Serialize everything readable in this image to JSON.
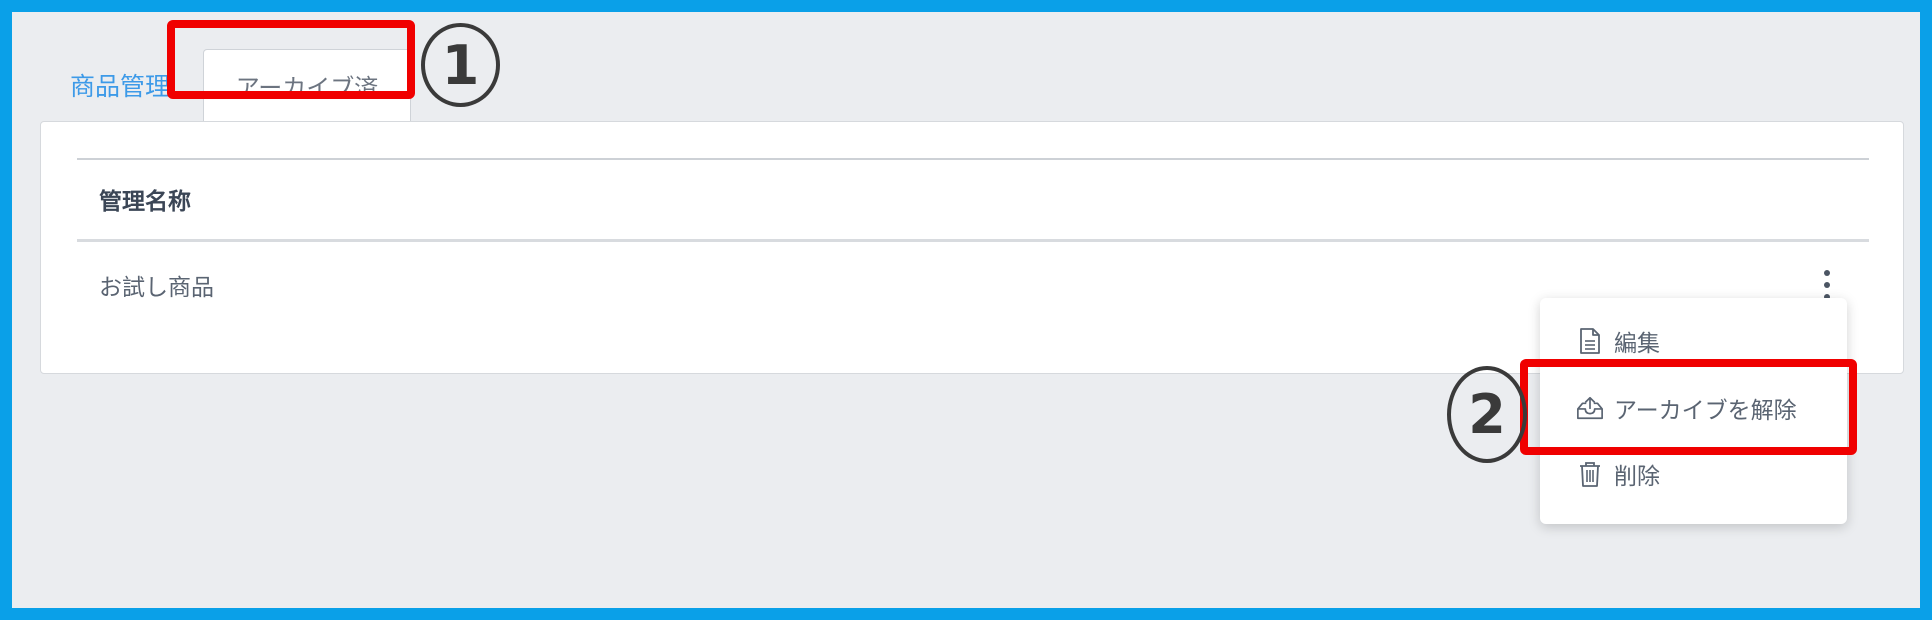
{
  "tabs": {
    "products": "商品管理",
    "archived": "アーカイブ済"
  },
  "annotations": {
    "step1": "1",
    "step2": "2"
  },
  "table": {
    "columns": [
      "管理名称"
    ],
    "rows": [
      {
        "name": "お試し商品"
      }
    ]
  },
  "row_menu": {
    "items": [
      {
        "label": "編集",
        "icon": "document-icon"
      },
      {
        "label": "アーカイブを解除",
        "icon": "unarchive-icon"
      },
      {
        "label": "削除",
        "icon": "trash-icon"
      }
    ]
  },
  "colors": {
    "frame_border": "#0aa0e8",
    "highlight": "#f00000",
    "link": "#3d9ae8"
  }
}
